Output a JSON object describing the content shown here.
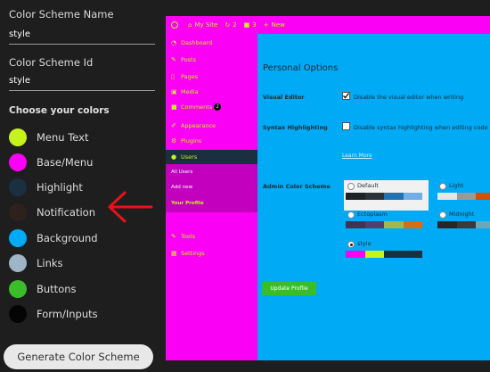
{
  "scheme_name": {
    "label": "Color Scheme Name",
    "value": "style"
  },
  "scheme_id": {
    "label": "Color Scheme Id",
    "value": "style"
  },
  "colors_title": "Choose your colors",
  "colors": [
    {
      "label": "Menu Text",
      "color": "#c8f21c",
      "icon": "color-swatch"
    },
    {
      "label": "Base/Menu",
      "color": "#fa00f4",
      "icon": "color-swatch"
    },
    {
      "label": "Highlight",
      "color": "#1a3040",
      "icon": "color-swatch"
    },
    {
      "label": "Notification",
      "color": "#2e201c",
      "icon": "color-swatch"
    },
    {
      "label": "Background",
      "color": "#00aaf4",
      "icon": "color-swatch"
    },
    {
      "label": "Links",
      "color": "#9eb5c8",
      "icon": "color-swatch"
    },
    {
      "label": "Buttons",
      "color": "#3bbd2a",
      "icon": "color-swatch"
    },
    {
      "label": "Form/Inputs",
      "color": "#050505",
      "icon": "color-swatch"
    }
  ],
  "generate_button": "Generate Color Scheme",
  "annotation": {
    "icon": "arrow-left-icon",
    "color": "#e8111b"
  },
  "preview": {
    "adminbar": {
      "site": "My Site",
      "comments_count": "2",
      "updates_count": "3",
      "new_label": "New"
    },
    "menu": [
      {
        "label": "Dashboard",
        "icon": "gauge-icon"
      },
      {
        "label": "Posts",
        "icon": "pin-icon"
      },
      {
        "label": "Pages",
        "icon": "page-icon"
      },
      {
        "label": "Media",
        "icon": "media-icon"
      },
      {
        "label": "Comments",
        "icon": "comment-icon",
        "badge": "2"
      },
      {
        "label": "Appearance",
        "icon": "brush-icon"
      },
      {
        "label": "Plugins",
        "icon": "plug-icon"
      },
      {
        "label": "Users",
        "icon": "user-icon",
        "active": true
      },
      {
        "label": "Tools",
        "icon": "wrench-icon"
      },
      {
        "label": "Settings",
        "icon": "settings-icon"
      }
    ],
    "submenu": [
      "All Users",
      "Add new",
      "Your Profile"
    ],
    "page_title": "Personal Options",
    "visual_editor": {
      "label": "Visual Editor",
      "option": "Disable the visual editor when writing",
      "checked": true
    },
    "syntax": {
      "label": "Syntax Highlighting",
      "option": "Disable syntax highlighting when editing code",
      "checked": false
    },
    "learn_more": "Learn More",
    "admin_scheme_label": "Admin Color Scheme",
    "schemes": [
      {
        "name": "Default",
        "selected": false,
        "highlighted": true,
        "colors": [
          "#1d2327",
          "#2c3338",
          "#2271b1",
          "#72aee6"
        ]
      },
      {
        "name": "Light",
        "selected": false,
        "highlighted": false,
        "colors": [
          "#e5e5e5",
          "#999999",
          "#d64e07",
          "#04a4cc"
        ]
      },
      {
        "name": "Ectoplasm",
        "selected": false,
        "highlighted": false,
        "colors": [
          "#413256",
          "#523f6d",
          "#a3b745",
          "#d46f15"
        ]
      },
      {
        "name": "Midnight",
        "selected": false,
        "highlighted": false,
        "colors": [
          "#25282b",
          "#363b3f",
          "#69a8bb",
          "#e14d43"
        ]
      },
      {
        "name": "style",
        "selected": true,
        "highlighted": false,
        "colors": [
          "#fa00f4",
          "#c8f21c",
          "#1a3040",
          "#1a3040"
        ]
      }
    ],
    "update_button": "Update Profile"
  }
}
